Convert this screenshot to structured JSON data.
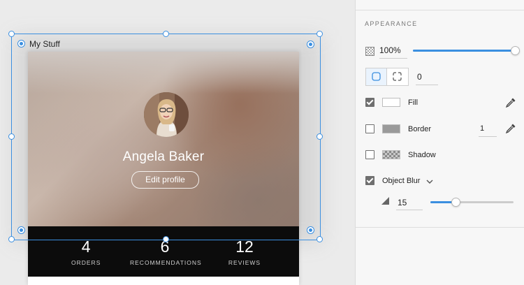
{
  "canvas": {
    "artboard_title": "My Stuff",
    "profile": {
      "name": "Angela Baker",
      "edit_button": "Edit profile"
    },
    "stats": [
      {
        "value": "4",
        "label": "ORDERS"
      },
      {
        "value": "6",
        "label": "RECOMMENDATIONS"
      },
      {
        "value": "12",
        "label": "REVIEWS"
      }
    ]
  },
  "panel": {
    "section_title": "APPEARANCE",
    "opacity": {
      "value": "100%",
      "level": 1.0
    },
    "corner_radius": {
      "value": "0"
    },
    "fill": {
      "label": "Fill",
      "checked": true,
      "color": "#ffffff"
    },
    "border": {
      "label": "Border",
      "checked": false,
      "color": "#9a9a9a",
      "width": "1"
    },
    "shadow": {
      "label": "Shadow",
      "checked": false
    },
    "object_blur": {
      "label": "Object Blur",
      "checked": true,
      "amount": "15",
      "level": 0.3
    }
  },
  "colors": {
    "accent": "#3b8fe0",
    "stats_bar": "#0c0c0c",
    "panel_bg": "#f7f7f7"
  },
  "icons": [
    "opacity-checker-icon",
    "rounded-corner-icon",
    "independent-corners-icon",
    "eyedropper-icon",
    "chevron-down-icon",
    "blur-icon",
    "artboard-target-icon"
  ]
}
